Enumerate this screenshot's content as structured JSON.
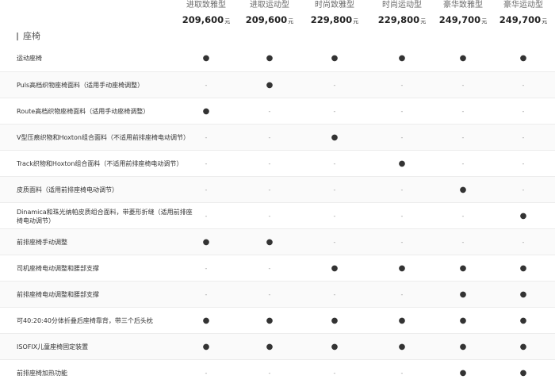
{
  "trims": [
    {
      "name": "进取致雅型",
      "price": "209,600",
      "unit": "元"
    },
    {
      "name": "进取运动型",
      "price": "209,600",
      "unit": "元"
    },
    {
      "name": "时尚致雅型",
      "price": "229,800",
      "unit": "元"
    },
    {
      "name": "时尚运动型",
      "price": "229,800",
      "unit": "元"
    },
    {
      "name": "豪华致雅型",
      "price": "249,700",
      "unit": "元"
    },
    {
      "name": "豪华运动型",
      "price": "249,700",
      "unit": "元"
    }
  ],
  "section": {
    "title": "座椅"
  },
  "symbols": {
    "standard": "●",
    "none": "-"
  },
  "rows": [
    {
      "label": "运动座椅",
      "values": [
        "●",
        "●",
        "●",
        "●",
        "●",
        "●"
      ]
    },
    {
      "label": "Puls高档织物座椅面料（适用手动座椅调整）",
      "values": [
        "-",
        "●",
        "-",
        "-",
        "-",
        "-"
      ]
    },
    {
      "label": "Route高档织物座椅面料（适用手动座椅调整）",
      "values": [
        "●",
        "-",
        "-",
        "-",
        "-",
        "-"
      ]
    },
    {
      "label": "V型压痕织物和Hoxton组合面料（不适用前排座椅电动调节）",
      "values": [
        "-",
        "-",
        "●",
        "-",
        "-",
        "-"
      ]
    },
    {
      "label": "Track织物和Hoxton组合面料（不适用前排座椅电动调节）",
      "values": [
        "-",
        "-",
        "-",
        "●",
        "-",
        "-"
      ]
    },
    {
      "label": "皮质面料（适用前排座椅电动调节）",
      "values": [
        "-",
        "-",
        "-",
        "-",
        "●",
        "-"
      ]
    },
    {
      "label": "Dinamica和珠光纳帕皮质组合面料，带菱形折缝（适用前排座椅电动调节）",
      "values": [
        "-",
        "-",
        "-",
        "-",
        "-",
        "●"
      ]
    },
    {
      "label": "前排座椅手动调整",
      "values": [
        "●",
        "●",
        "-",
        "-",
        "-",
        "-"
      ]
    },
    {
      "label": "司机座椅电动调整和腰部支撑",
      "values": [
        "-",
        "-",
        "●",
        "●",
        "●",
        "●"
      ]
    },
    {
      "label": "前排座椅电动调整和腰部支撑",
      "values": [
        "-",
        "-",
        "-",
        "-",
        "●",
        "●"
      ]
    },
    {
      "label": "可40:20:40分体折叠后座椅靠背，带三个后头枕",
      "values": [
        "●",
        "●",
        "●",
        "●",
        "●",
        "●"
      ]
    },
    {
      "label": "ISOFIX儿童座椅固定装置",
      "values": [
        "●",
        "●",
        "●",
        "●",
        "●",
        "●"
      ]
    },
    {
      "label": "前排座椅加热功能",
      "values": [
        "-",
        "-",
        "-",
        "-",
        "●",
        "●"
      ]
    }
  ]
}
